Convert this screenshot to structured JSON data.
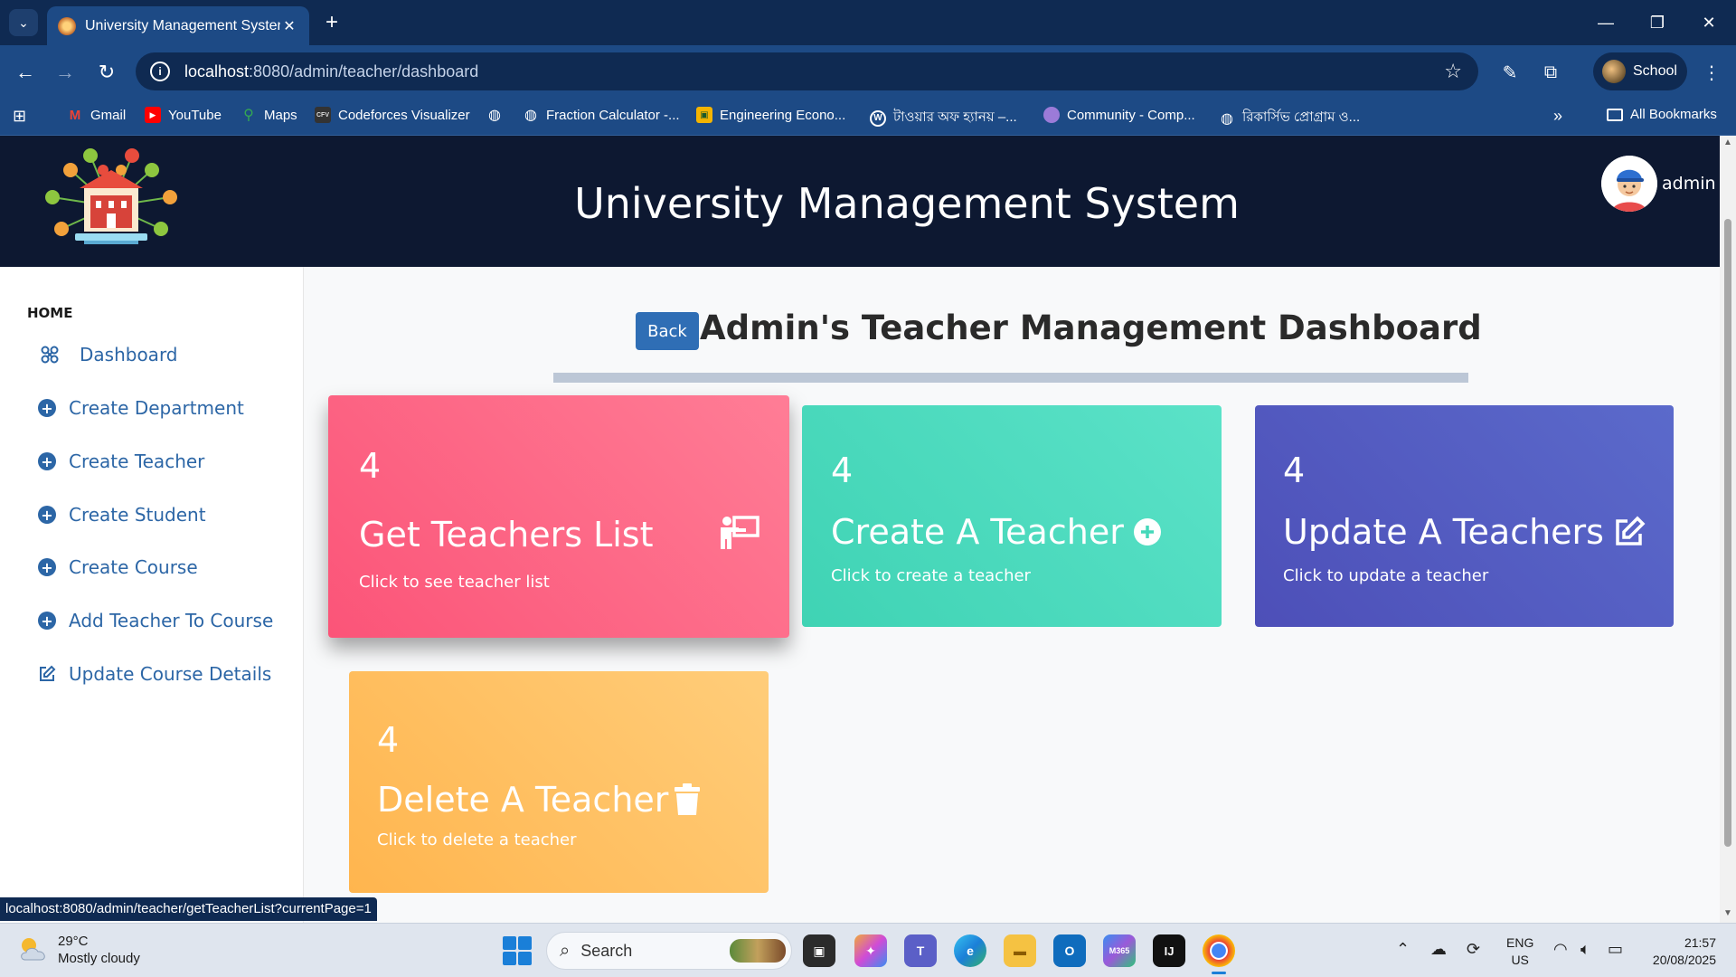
{
  "browser": {
    "tab_title": "University Management System",
    "tab_close": "✕",
    "new_tab": "+",
    "url_host": "localhost",
    "url_path": ":8080/admin/teacher/dashboard",
    "profile_name": "School",
    "window_controls": {
      "minimize": "—",
      "restore": "❐",
      "close": "✕"
    },
    "bookmarks": [
      {
        "label": "Gmail",
        "icon": "gmail-icon"
      },
      {
        "label": "YouTube",
        "icon": "youtube-icon"
      },
      {
        "label": "Maps",
        "icon": "maps-icon"
      },
      {
        "label": "Codeforces Visualizer",
        "icon": "cfv-icon"
      },
      {
        "label": "",
        "icon": "globe-icon"
      },
      {
        "label": "Fraction Calculator -...",
        "icon": "globe-icon"
      },
      {
        "label": "Engineering Econo...",
        "icon": "classroom-icon"
      },
      {
        "label": "টাওয়ার অফ হ্যানয় –...",
        "icon": "wordpress-icon"
      },
      {
        "label": "Community - Comp...",
        "icon": "community-icon"
      },
      {
        "label": "রিকার্সিভ প্রোগ্রাম ও...",
        "icon": "globe-icon"
      }
    ],
    "all_bookmarks": "All Bookmarks",
    "overflow": "»",
    "status_url": "localhost:8080/admin/teacher/getTeacherList?currentPage=1"
  },
  "header": {
    "title": "University Management System",
    "admin_name": "admin"
  },
  "sidebar": {
    "heading": "HOME",
    "items": [
      {
        "label": "Dashboard",
        "icon": "dashboard-icon"
      },
      {
        "label": "Create Department",
        "icon": "plus-circle-icon"
      },
      {
        "label": "Create Teacher",
        "icon": "plus-circle-icon"
      },
      {
        "label": "Create Student",
        "icon": "plus-circle-icon"
      },
      {
        "label": "Create Course",
        "icon": "plus-circle-icon"
      },
      {
        "label": "Add Teacher To Course",
        "icon": "plus-circle-icon"
      },
      {
        "label": "Update Course Details",
        "icon": "edit-icon"
      }
    ]
  },
  "main": {
    "back_label": "Back",
    "title": "Admin's Teacher Management Dashboard",
    "cards": [
      {
        "count": "4",
        "title": "Get Teachers List",
        "subtitle": "Click to see teacher list",
        "icon": "teacher-board-icon",
        "color": "#fb5478"
      },
      {
        "count": "4",
        "title": "Create A Teacher",
        "subtitle": "Click to create a teacher",
        "icon": "plus-circle-icon",
        "color": "#3fd3b4"
      },
      {
        "count": "4",
        "title": "Update A Teachers",
        "subtitle": "Click to update a teacher",
        "icon": "edit-icon",
        "color": "#4d4fb8"
      },
      {
        "count": "4",
        "title": "Delete A Teacher",
        "subtitle": "Click to delete a teacher",
        "icon": "trash-icon",
        "color": "#ffb54e"
      }
    ]
  },
  "taskbar": {
    "temperature": "29°C",
    "weather": "Mostly cloudy",
    "search_placeholder": "Search",
    "lang": "ENG",
    "region": "US",
    "time": "21:57",
    "date": "20/08/2025"
  }
}
